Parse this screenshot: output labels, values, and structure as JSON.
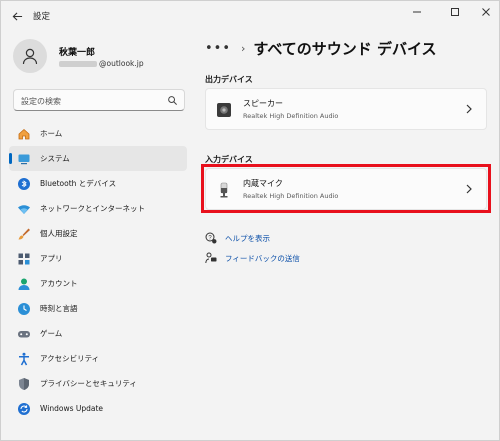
{
  "app": {
    "title": "設定"
  },
  "window_controls": {
    "minimize": "—",
    "maximize": "☐",
    "close": "✕"
  },
  "user": {
    "name": "秋葉一郎",
    "email_domain": "@outlook.jp"
  },
  "search": {
    "placeholder": "設定の検索"
  },
  "sidebar": {
    "items": [
      {
        "label": "ホーム",
        "icon": "home-icon",
        "selected": false
      },
      {
        "label": "システム",
        "icon": "system-icon",
        "selected": true
      },
      {
        "label": "Bluetooth とデバイス",
        "icon": "bluetooth-icon",
        "selected": false
      },
      {
        "label": "ネットワークとインターネット",
        "icon": "network-icon",
        "selected": false
      },
      {
        "label": "個人用設定",
        "icon": "brush-icon",
        "selected": false
      },
      {
        "label": "アプリ",
        "icon": "apps-icon",
        "selected": false
      },
      {
        "label": "アカウント",
        "icon": "account-icon",
        "selected": false
      },
      {
        "label": "時刻と言語",
        "icon": "time-language-icon",
        "selected": false
      },
      {
        "label": "ゲーム",
        "icon": "gamepad-icon",
        "selected": false
      },
      {
        "label": "アクセシビリティ",
        "icon": "accessibility-icon",
        "selected": false
      },
      {
        "label": "プライバシーとセキュリティ",
        "icon": "shield-icon",
        "selected": false
      },
      {
        "label": "Windows Update",
        "icon": "update-icon",
        "selected": false
      }
    ]
  },
  "breadcrumb": {
    "dots": "•••",
    "separator": "›",
    "title": "すべてのサウンド デバイス"
  },
  "output_section": {
    "title": "出力デバイス",
    "device": {
      "name": "スピーカー",
      "driver": "Realtek High Definition Audio"
    }
  },
  "input_section": {
    "title": "入力デバイス",
    "device": {
      "name": "内蔵マイク",
      "driver": "Realtek High Definition Audio"
    }
  },
  "links": {
    "help": "ヘルプを表示",
    "feedback": "フィードバックの送信"
  },
  "colors": {
    "accent": "#0067c0",
    "highlight": "#e8101c"
  }
}
